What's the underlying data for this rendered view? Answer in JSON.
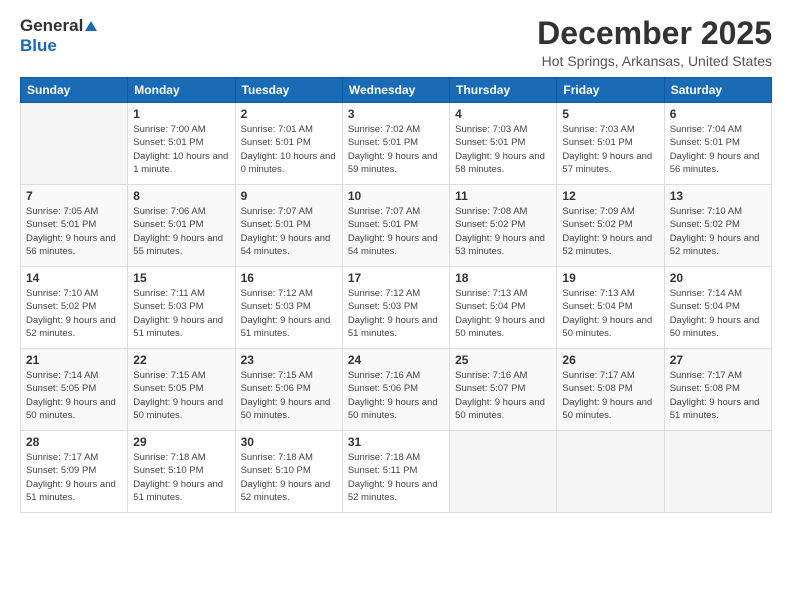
{
  "logo": {
    "general": "General",
    "blue": "Blue"
  },
  "title": "December 2025",
  "location": "Hot Springs, Arkansas, United States",
  "weekdays": [
    "Sunday",
    "Monday",
    "Tuesday",
    "Wednesday",
    "Thursday",
    "Friday",
    "Saturday"
  ],
  "weeks": [
    [
      {
        "day": "",
        "sunrise": "",
        "sunset": "",
        "daylight": ""
      },
      {
        "day": "1",
        "sunrise": "Sunrise: 7:00 AM",
        "sunset": "Sunset: 5:01 PM",
        "daylight": "Daylight: 10 hours and 1 minute."
      },
      {
        "day": "2",
        "sunrise": "Sunrise: 7:01 AM",
        "sunset": "Sunset: 5:01 PM",
        "daylight": "Daylight: 10 hours and 0 minutes."
      },
      {
        "day": "3",
        "sunrise": "Sunrise: 7:02 AM",
        "sunset": "Sunset: 5:01 PM",
        "daylight": "Daylight: 9 hours and 59 minutes."
      },
      {
        "day": "4",
        "sunrise": "Sunrise: 7:03 AM",
        "sunset": "Sunset: 5:01 PM",
        "daylight": "Daylight: 9 hours and 58 minutes."
      },
      {
        "day": "5",
        "sunrise": "Sunrise: 7:03 AM",
        "sunset": "Sunset: 5:01 PM",
        "daylight": "Daylight: 9 hours and 57 minutes."
      },
      {
        "day": "6",
        "sunrise": "Sunrise: 7:04 AM",
        "sunset": "Sunset: 5:01 PM",
        "daylight": "Daylight: 9 hours and 56 minutes."
      }
    ],
    [
      {
        "day": "7",
        "sunrise": "Sunrise: 7:05 AM",
        "sunset": "Sunset: 5:01 PM",
        "daylight": "Daylight: 9 hours and 56 minutes."
      },
      {
        "day": "8",
        "sunrise": "Sunrise: 7:06 AM",
        "sunset": "Sunset: 5:01 PM",
        "daylight": "Daylight: 9 hours and 55 minutes."
      },
      {
        "day": "9",
        "sunrise": "Sunrise: 7:07 AM",
        "sunset": "Sunset: 5:01 PM",
        "daylight": "Daylight: 9 hours and 54 minutes."
      },
      {
        "day": "10",
        "sunrise": "Sunrise: 7:07 AM",
        "sunset": "Sunset: 5:01 PM",
        "daylight": "Daylight: 9 hours and 54 minutes."
      },
      {
        "day": "11",
        "sunrise": "Sunrise: 7:08 AM",
        "sunset": "Sunset: 5:02 PM",
        "daylight": "Daylight: 9 hours and 53 minutes."
      },
      {
        "day": "12",
        "sunrise": "Sunrise: 7:09 AM",
        "sunset": "Sunset: 5:02 PM",
        "daylight": "Daylight: 9 hours and 52 minutes."
      },
      {
        "day": "13",
        "sunrise": "Sunrise: 7:10 AM",
        "sunset": "Sunset: 5:02 PM",
        "daylight": "Daylight: 9 hours and 52 minutes."
      }
    ],
    [
      {
        "day": "14",
        "sunrise": "Sunrise: 7:10 AM",
        "sunset": "Sunset: 5:02 PM",
        "daylight": "Daylight: 9 hours and 52 minutes."
      },
      {
        "day": "15",
        "sunrise": "Sunrise: 7:11 AM",
        "sunset": "Sunset: 5:03 PM",
        "daylight": "Daylight: 9 hours and 51 minutes."
      },
      {
        "day": "16",
        "sunrise": "Sunrise: 7:12 AM",
        "sunset": "Sunset: 5:03 PM",
        "daylight": "Daylight: 9 hours and 51 minutes."
      },
      {
        "day": "17",
        "sunrise": "Sunrise: 7:12 AM",
        "sunset": "Sunset: 5:03 PM",
        "daylight": "Daylight: 9 hours and 51 minutes."
      },
      {
        "day": "18",
        "sunrise": "Sunrise: 7:13 AM",
        "sunset": "Sunset: 5:04 PM",
        "daylight": "Daylight: 9 hours and 50 minutes."
      },
      {
        "day": "19",
        "sunrise": "Sunrise: 7:13 AM",
        "sunset": "Sunset: 5:04 PM",
        "daylight": "Daylight: 9 hours and 50 minutes."
      },
      {
        "day": "20",
        "sunrise": "Sunrise: 7:14 AM",
        "sunset": "Sunset: 5:04 PM",
        "daylight": "Daylight: 9 hours and 50 minutes."
      }
    ],
    [
      {
        "day": "21",
        "sunrise": "Sunrise: 7:14 AM",
        "sunset": "Sunset: 5:05 PM",
        "daylight": "Daylight: 9 hours and 50 minutes."
      },
      {
        "day": "22",
        "sunrise": "Sunrise: 7:15 AM",
        "sunset": "Sunset: 5:05 PM",
        "daylight": "Daylight: 9 hours and 50 minutes."
      },
      {
        "day": "23",
        "sunrise": "Sunrise: 7:15 AM",
        "sunset": "Sunset: 5:06 PM",
        "daylight": "Daylight: 9 hours and 50 minutes."
      },
      {
        "day": "24",
        "sunrise": "Sunrise: 7:16 AM",
        "sunset": "Sunset: 5:06 PM",
        "daylight": "Daylight: 9 hours and 50 minutes."
      },
      {
        "day": "25",
        "sunrise": "Sunrise: 7:16 AM",
        "sunset": "Sunset: 5:07 PM",
        "daylight": "Daylight: 9 hours and 50 minutes."
      },
      {
        "day": "26",
        "sunrise": "Sunrise: 7:17 AM",
        "sunset": "Sunset: 5:08 PM",
        "daylight": "Daylight: 9 hours and 50 minutes."
      },
      {
        "day": "27",
        "sunrise": "Sunrise: 7:17 AM",
        "sunset": "Sunset: 5:08 PM",
        "daylight": "Daylight: 9 hours and 51 minutes."
      }
    ],
    [
      {
        "day": "28",
        "sunrise": "Sunrise: 7:17 AM",
        "sunset": "Sunset: 5:09 PM",
        "daylight": "Daylight: 9 hours and 51 minutes."
      },
      {
        "day": "29",
        "sunrise": "Sunrise: 7:18 AM",
        "sunset": "Sunset: 5:10 PM",
        "daylight": "Daylight: 9 hours and 51 minutes."
      },
      {
        "day": "30",
        "sunrise": "Sunrise: 7:18 AM",
        "sunset": "Sunset: 5:10 PM",
        "daylight": "Daylight: 9 hours and 52 minutes."
      },
      {
        "day": "31",
        "sunrise": "Sunrise: 7:18 AM",
        "sunset": "Sunset: 5:11 PM",
        "daylight": "Daylight: 9 hours and 52 minutes."
      },
      {
        "day": "",
        "sunrise": "",
        "sunset": "",
        "daylight": ""
      },
      {
        "day": "",
        "sunrise": "",
        "sunset": "",
        "daylight": ""
      },
      {
        "day": "",
        "sunrise": "",
        "sunset": "",
        "daylight": ""
      }
    ]
  ]
}
